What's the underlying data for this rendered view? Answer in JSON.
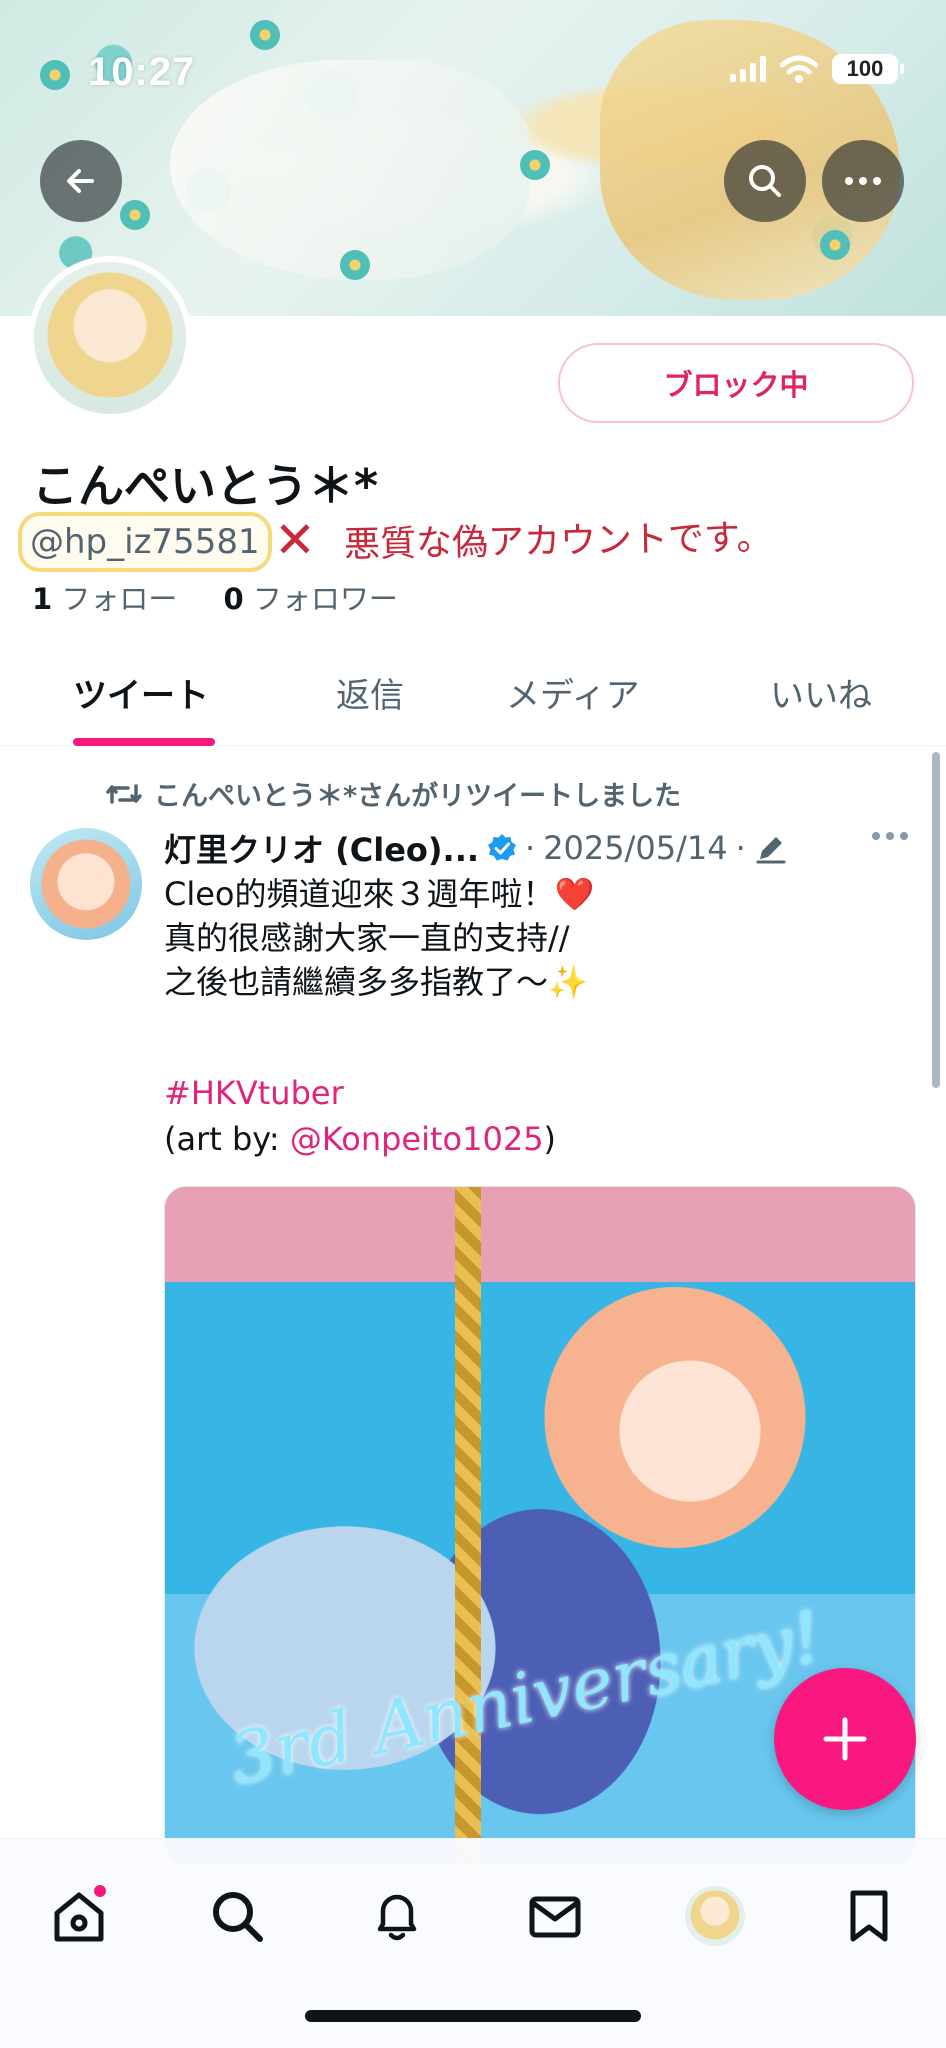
{
  "status_bar": {
    "time": "10:27",
    "battery": "100"
  },
  "header": {
    "back_icon": "arrow-left-icon",
    "search_icon": "search-icon",
    "more_icon": "more-horizontal-icon"
  },
  "profile": {
    "display_name": "こんぺいとう＊*",
    "handle": "@hp_iz75581",
    "block_button": "ブロック中",
    "following_count": "1",
    "following_label": "フォロー",
    "followers_count": "0",
    "followers_label": "フォロワー",
    "annotation_mark": "✕",
    "annotation_text": "悪質な偽アカウントです。"
  },
  "tabs": [
    {
      "label": "ツイート",
      "active": true
    },
    {
      "label": "返信",
      "active": false
    },
    {
      "label": "メディア",
      "active": false
    },
    {
      "label": "いいね",
      "active": false
    }
  ],
  "tweet": {
    "retweet_notice": "こんぺいとう＊*さんがリツイートしました",
    "author": "灯里クリオ (Cleo)...",
    "separator": "·",
    "date": "2025/05/14",
    "body": "Cleo的頻道迎來３週年啦！❤️\n真的很感謝大家一直的支持//\n之後也請繼續多多指教了～✨",
    "hashtag": "#HKVtuber",
    "credit_prefix": "(art by: ",
    "credit_mention": "@Konpeito1025",
    "credit_suffix": ")",
    "media_caption": "3rd Anniversary!"
  },
  "colors": {
    "accent": "#f91880",
    "link": "#e0247c",
    "block": "#e0245e",
    "verified": "#1d9bf0",
    "annotation": "#c8283a"
  },
  "bottom_nav": [
    "home-icon",
    "search-icon",
    "bell-icon",
    "mail-icon",
    "profile-avatar",
    "bookmark-icon"
  ]
}
